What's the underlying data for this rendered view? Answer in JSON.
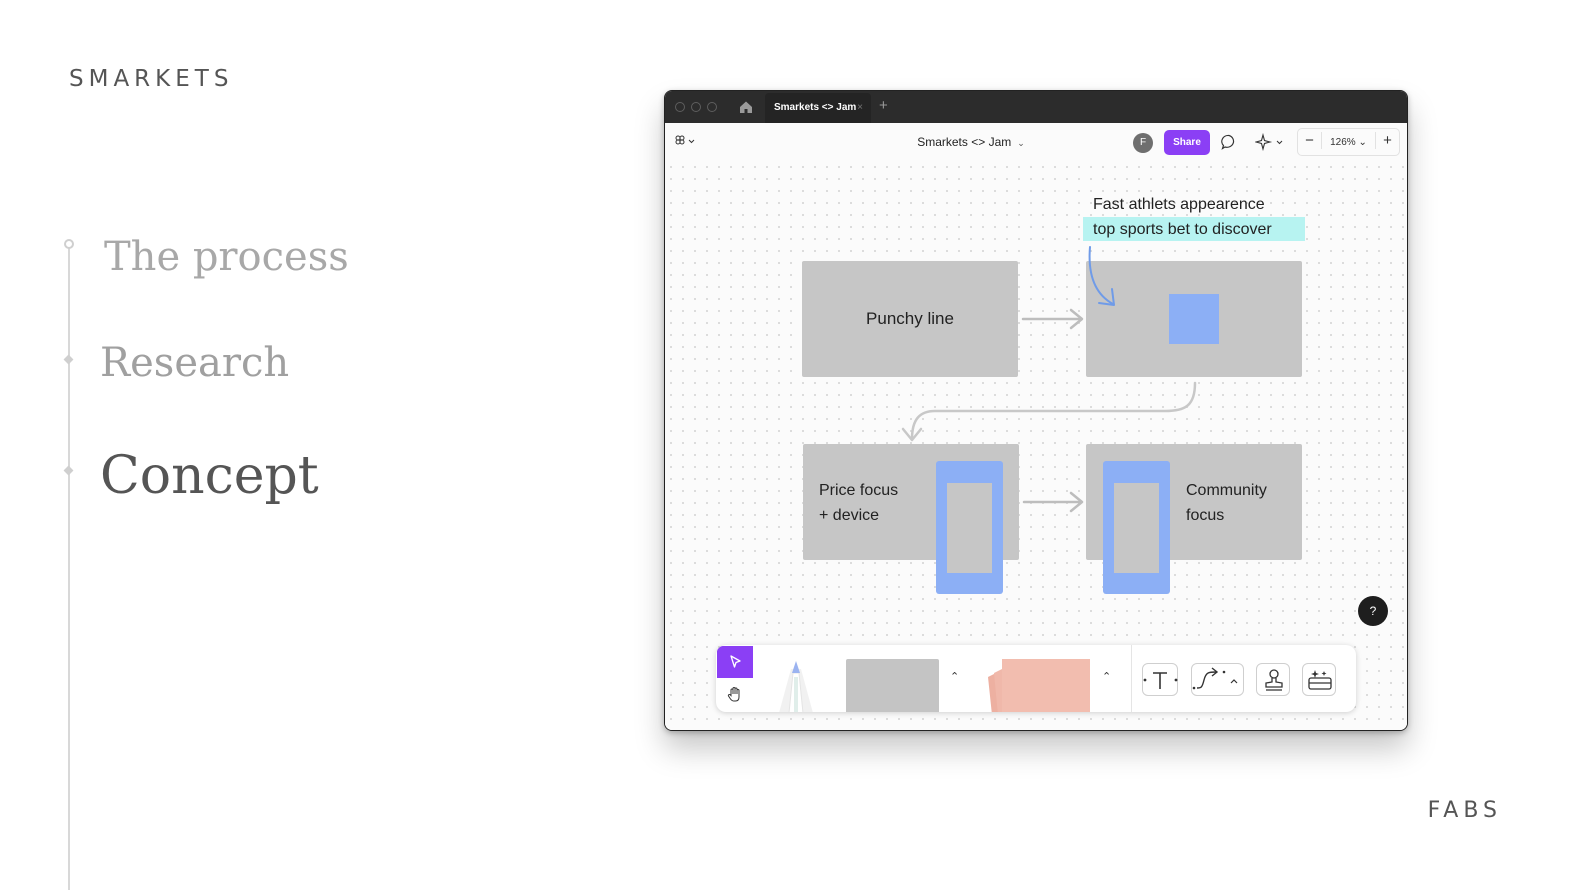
{
  "brand": "SMARKETS",
  "footer_brand": "FABS",
  "steps": {
    "process": "The process",
    "research": "Research",
    "concept": "Concept"
  },
  "window": {
    "tab_title": "Smarkets <> Jam",
    "tab_close": "×",
    "new_tab": "+",
    "file_title": "Smarkets <> Jam",
    "avatar_initial": "F",
    "share_label": "Share",
    "zoom_minus": "−",
    "zoom_value": "126%",
    "zoom_caret": "⌄",
    "zoom_plus": "+",
    "help_label": "?"
  },
  "canvas": {
    "annotation_line1": "Fast athlets appearence",
    "annotation_line2": "top sports bet to discover",
    "card_punchy": "Punchy line",
    "card_price_line1": "Price focus",
    "card_price_line2": "+ device",
    "card_community_line1": "Community",
    "card_community_line2": "focus"
  },
  "colors": {
    "accent_purple": "#8b3ff5",
    "card_gray": "#c6c6c6",
    "phone_blue": "#8caff5",
    "highlight_cyan": "#b7f3f1",
    "sticky_pink": "#f2bdaf"
  },
  "icons": [
    "home-icon",
    "menu-icon",
    "comment-icon",
    "ai-sparkle-icon",
    "select-arrow-icon",
    "hand-icon",
    "pencil-icon",
    "text-tool-icon",
    "connector-icon",
    "stamp-icon",
    "widgets-icon",
    "chevron-up-icon"
  ]
}
